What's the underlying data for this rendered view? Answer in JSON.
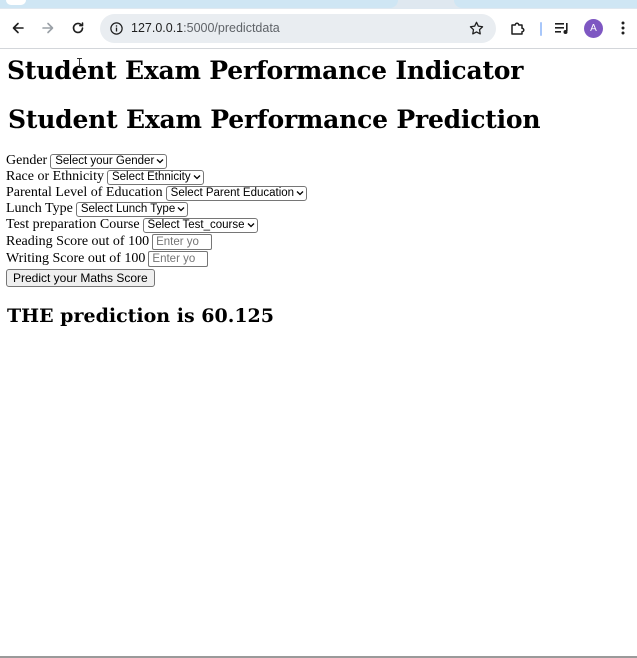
{
  "browser": {
    "url_host": "127.0.0.1",
    "url_rest": ":5000/predictdata",
    "profile_initial": "A",
    "icons": [
      "back-icon",
      "forward-icon",
      "reload-icon",
      "site-info-icon",
      "bookmark-star-icon",
      "extensions-icon",
      "media-queue-icon",
      "profile-avatar",
      "more-menu-icon"
    ]
  },
  "page": {
    "heading_indicator": "Student Exam Performance Indicator",
    "heading_prediction": "Student Exam Performance Prediction",
    "form": {
      "gender_label": "Gender",
      "gender_select": "Select your Gender",
      "ethnicity_label": "Race or Ethnicity",
      "ethnicity_select": "Select Ethnicity",
      "parent_edu_label": "Parental Level of Education",
      "parent_edu_select": "Select Parent Education",
      "lunch_label": "Lunch Type",
      "lunch_select": "Select Lunch Type",
      "test_prep_label": "Test preparation Course",
      "test_prep_select": "Select Test_course",
      "reading_label": "Reading Score out of 100",
      "reading_placeholder": "Enter yo",
      "writing_label": "Writing Score out of 100",
      "writing_placeholder": "Enter yo",
      "submit_label": "Predict your Maths Score"
    },
    "result": "THE prediction is 60.125"
  },
  "colors": {
    "accent_avatar": "#7e57c2",
    "omnibox_bg": "#e9edf1",
    "tab_bg": "#cfe6f4"
  }
}
